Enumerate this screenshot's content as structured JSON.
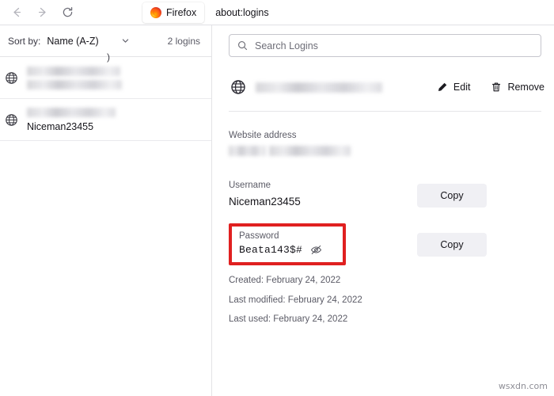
{
  "browser": {
    "nav": {
      "back_icon": "arrow-left-icon",
      "forward_icon": "arrow-right-icon",
      "reload_icon": "reload-icon"
    },
    "tab": {
      "title": "Firefox",
      "favicon": "firefox-logo-icon"
    },
    "url": "about:logins"
  },
  "sidebar": {
    "sort_label": "Sort by:",
    "sort_value": "Name (A-Z)",
    "sort_chevron_icon": "chevron-down-icon",
    "login_count": "2 logins",
    "items": [
      {
        "icon": "globe-icon",
        "title_redacted": true,
        "username_redacted": true,
        "trailing_char": ")"
      },
      {
        "icon": "globe-icon",
        "title_redacted": true,
        "username": "Niceman23455"
      }
    ]
  },
  "detail": {
    "search": {
      "icon": "search-icon",
      "placeholder": "Search Logins"
    },
    "header": {
      "icon": "globe-icon",
      "title_redacted": true,
      "edit_label": "Edit",
      "edit_icon": "pencil-icon",
      "remove_label": "Remove",
      "remove_icon": "trash-icon"
    },
    "website": {
      "label": "Website address",
      "value_redacted": true
    },
    "username": {
      "label": "Username",
      "value": "Niceman23455",
      "copy_label": "Copy"
    },
    "password": {
      "label": "Password",
      "value": "Beata143$#",
      "toggle_icon": "eye-slash-icon",
      "copy_label": "Copy",
      "highlight_color": "#e02020"
    },
    "meta": [
      "Created: February 24, 2022",
      "Last modified: February 24, 2022",
      "Last used: February 24, 2022"
    ]
  },
  "watermark": "wsxdn.com"
}
